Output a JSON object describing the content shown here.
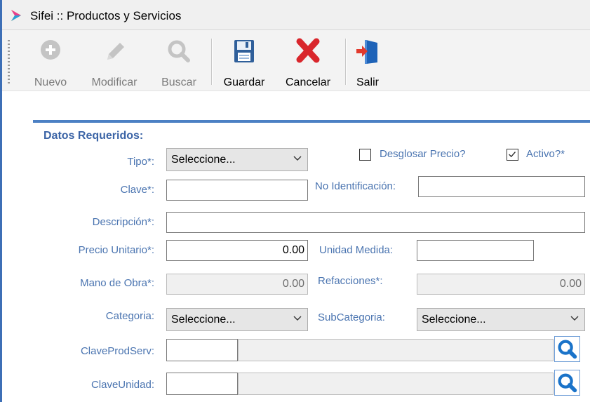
{
  "window": {
    "title": "Sifei :: Productos y Servicios"
  },
  "toolbar": {
    "nuevo": "Nuevo",
    "modificar": "Modificar",
    "buscar": "Buscar",
    "guardar": "Guardar",
    "cancelar": "Cancelar",
    "salir": "Salir"
  },
  "form": {
    "section_title": "Datos Requeridos:",
    "tipo": {
      "label": "Tipo*:",
      "value": "Seleccione..."
    },
    "desglosar": {
      "label": "Desglosar Precio?",
      "checked": false
    },
    "activo": {
      "label": "Activo?*",
      "checked": true
    },
    "clave": {
      "label": "Clave*:",
      "value": ""
    },
    "no_identificacion": {
      "label": "No Identificación:",
      "value": ""
    },
    "descripcion": {
      "label": "Descripción*:",
      "value": ""
    },
    "precio_unitario": {
      "label": "Precio Unitario*:",
      "value": "0.00"
    },
    "unidad_medida": {
      "label": "Unidad Medida:",
      "value": ""
    },
    "mano_obra": {
      "label": "Mano de Obra*:",
      "value": "0.00"
    },
    "refacciones": {
      "label": "Refacciones*:",
      "value": "0.00"
    },
    "categoria": {
      "label": "Categoria:",
      "value": "Seleccione..."
    },
    "subcategoria": {
      "label": "SubCategoria:",
      "value": "Seleccione..."
    },
    "clave_prod_serv": {
      "label": "ClaveProdServ:",
      "code": "",
      "description": ""
    },
    "clave_unidad": {
      "label": "ClaveUnidad:",
      "code": "",
      "description": ""
    }
  },
  "colors": {
    "label_blue": "#4a74b0",
    "accent_line": "#4c80c4",
    "cancel_red": "#d9262c",
    "search_blue": "#1a73c9"
  }
}
